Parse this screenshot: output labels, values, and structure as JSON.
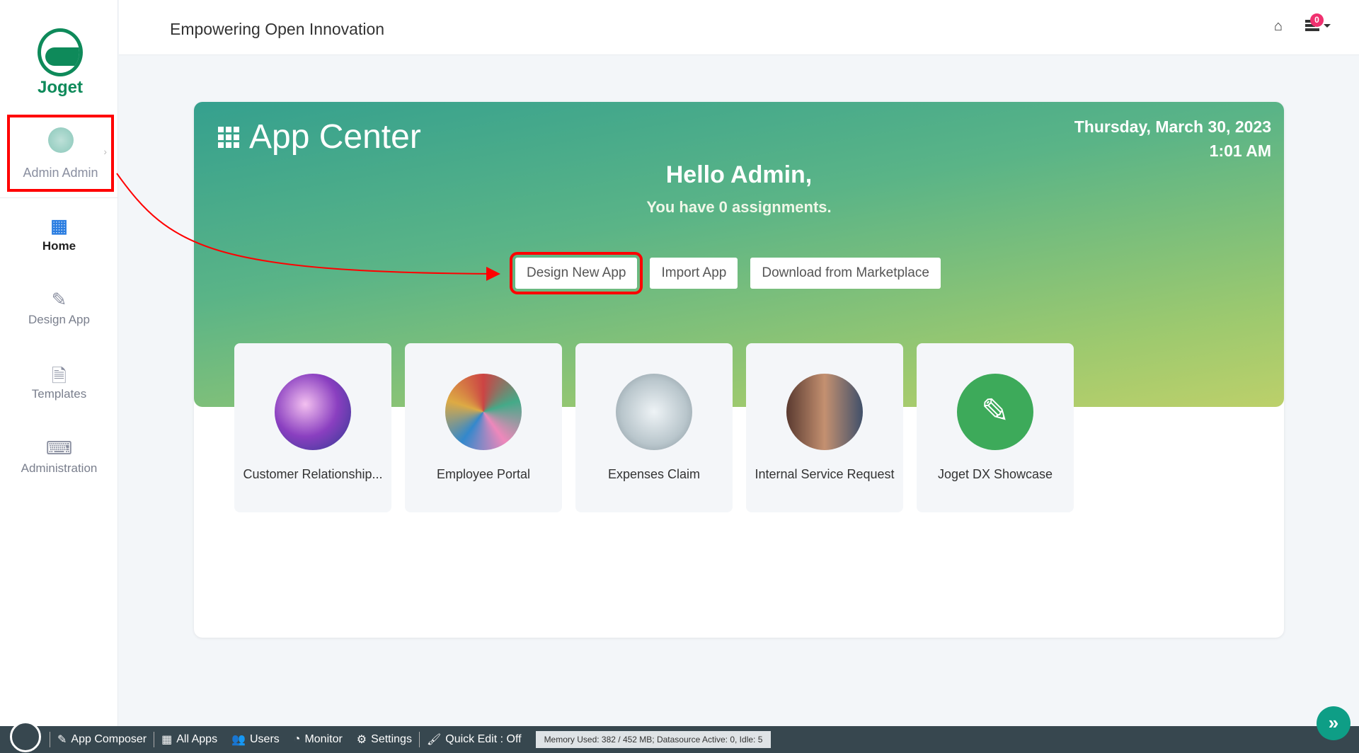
{
  "brand": {
    "name": "Joget"
  },
  "header": {
    "title": "Empowering Open Innovation",
    "notification_count": "0"
  },
  "sidebar": {
    "user": "Admin Admin",
    "items": [
      {
        "label": "Home",
        "icon": "grid-icon"
      },
      {
        "label": "Design App",
        "icon": "pencil-ruler-icon"
      },
      {
        "label": "Templates",
        "icon": "file-icon"
      },
      {
        "label": "Administration",
        "icon": "keyboard-icon"
      }
    ]
  },
  "main": {
    "title": "App Center",
    "date": "Thursday, March 30, 2023",
    "time": "1:01 AM",
    "greeting": "Hello Admin,",
    "assignments": "You have 0 assignments.",
    "buttons": [
      "Design New App",
      "Import App",
      "Download from Marketplace"
    ],
    "apps": [
      {
        "label": "Customer Relationship..."
      },
      {
        "label": "Employee Portal"
      },
      {
        "label": "Expenses Claim"
      },
      {
        "label": "Internal Service Request"
      },
      {
        "label": "Joget DX Showcase"
      }
    ]
  },
  "footer": {
    "items": [
      "App Composer",
      "All Apps",
      "Users",
      "Monitor",
      "Settings",
      "Quick Edit : Off"
    ],
    "memory": "Memory Used: 382 / 452 MB; Datasource Active: 0, Idle: 5"
  },
  "colors": {
    "accent": "#0e8a5a",
    "highlight": "#ff0000"
  }
}
